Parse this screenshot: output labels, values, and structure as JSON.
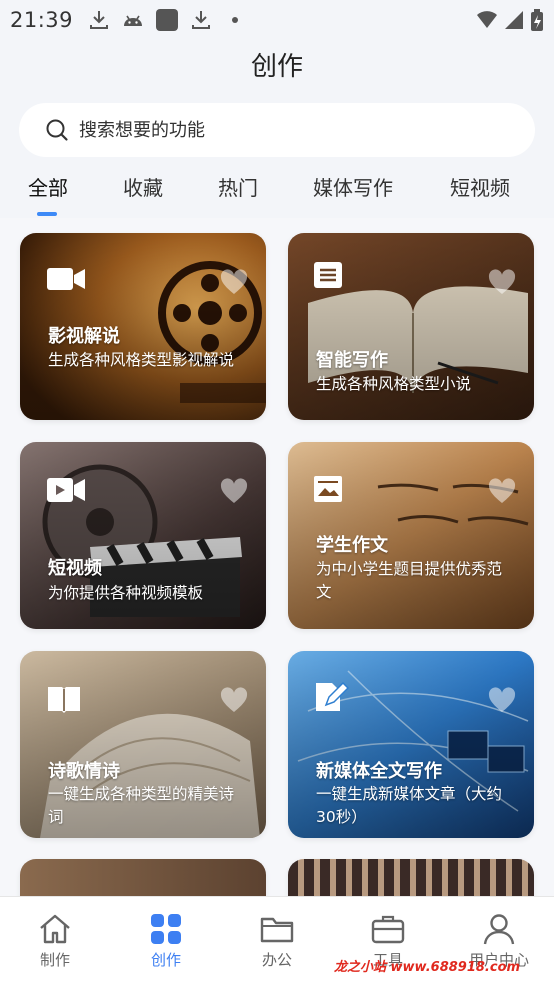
{
  "status_bar": {
    "time": "21:39"
  },
  "page_title": "创作",
  "search": {
    "placeholder": "搜索想要的功能"
  },
  "tabs": [
    {
      "label": "全部",
      "active": true
    },
    {
      "label": "收藏",
      "active": false
    },
    {
      "label": "热门",
      "active": false
    },
    {
      "label": "媒体写作",
      "active": false
    },
    {
      "label": "短视频",
      "active": false
    }
  ],
  "cards": [
    {
      "title": "影视解说",
      "description": "生成各种风格类型影视解说",
      "icon": "camera-icon"
    },
    {
      "title": "智能写作",
      "description": "生成各种风格类型小说",
      "icon": "document-icon"
    },
    {
      "title": "短视频",
      "description": "为你提供各种视频模板",
      "icon": "video-icon"
    },
    {
      "title": "学生作文",
      "description": "为中小学生题目提供优秀范文",
      "icon": "image-icon"
    },
    {
      "title": "诗歌情诗",
      "description": "一键生成各种类型的精美诗词",
      "icon": "book-icon"
    },
    {
      "title": "新媒体全文写作",
      "description": "一键生成新媒体文章（大约30秒）",
      "icon": "edit-icon"
    }
  ],
  "bottom_nav": [
    {
      "label": "制作",
      "icon": "home-icon",
      "active": false
    },
    {
      "label": "创作",
      "icon": "grid-icon",
      "active": true
    },
    {
      "label": "办公",
      "icon": "folder-icon",
      "active": false
    },
    {
      "label": "工具",
      "icon": "briefcase-icon",
      "active": false
    },
    {
      "label": "用户中心",
      "icon": "user-icon",
      "active": false
    }
  ],
  "watermark": "龙之小站 www.688918.com",
  "colors": {
    "accent": "#3d8af7",
    "background": "#f3f5f9"
  }
}
